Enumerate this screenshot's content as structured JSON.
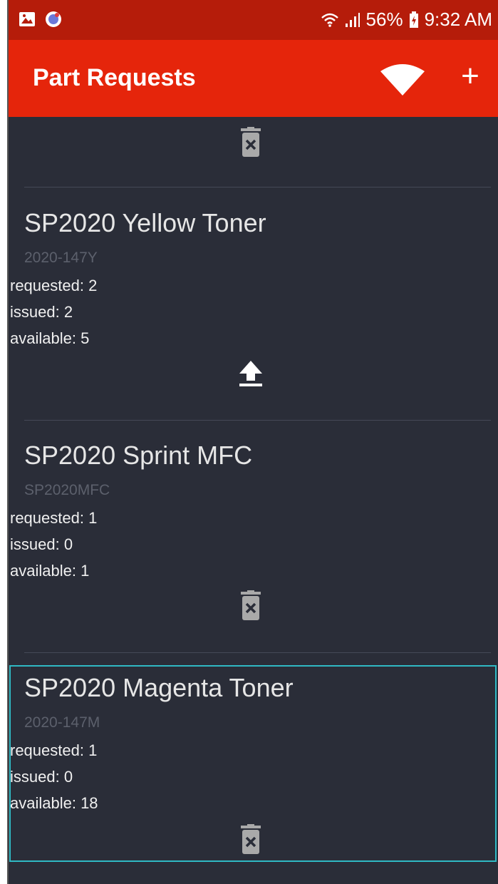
{
  "status_bar": {
    "battery": "56%",
    "time": "9:32 AM",
    "left_icons": [
      "image-icon",
      "messenger-icon"
    ],
    "right_icons": [
      "wifi-icon",
      "signal-icon",
      "battery-icon"
    ]
  },
  "app_bar": {
    "title": "Part Requests",
    "actions": [
      "wifi-icon",
      "add-icon"
    ],
    "add_label": "+"
  },
  "items": [
    {
      "action_icon": "trash-icon"
    },
    {
      "name": "SP2020 Yellow Toner",
      "code": "2020-147Y",
      "requested": "requested: 2",
      "issued": "issued: 2",
      "available": "available: 5",
      "action_icon": "upload-icon"
    },
    {
      "name": "SP2020 Sprint MFC",
      "code": "SP2020MFC",
      "requested": "requested: 1",
      "issued": "issued: 0",
      "available": "available: 1",
      "action_icon": "trash-icon"
    },
    {
      "name": "SP2020 Magenta Toner",
      "code": "2020-147M",
      "requested": "requested: 1",
      "issued": "issued: 0",
      "available": "available: 18",
      "action_icon": "trash-icon",
      "selected": true
    }
  ],
  "colors": {
    "status_bar": "#b51c0a",
    "app_bar": "#e5250b",
    "background": "#2a2d38",
    "selection": "#2fb9c4"
  }
}
